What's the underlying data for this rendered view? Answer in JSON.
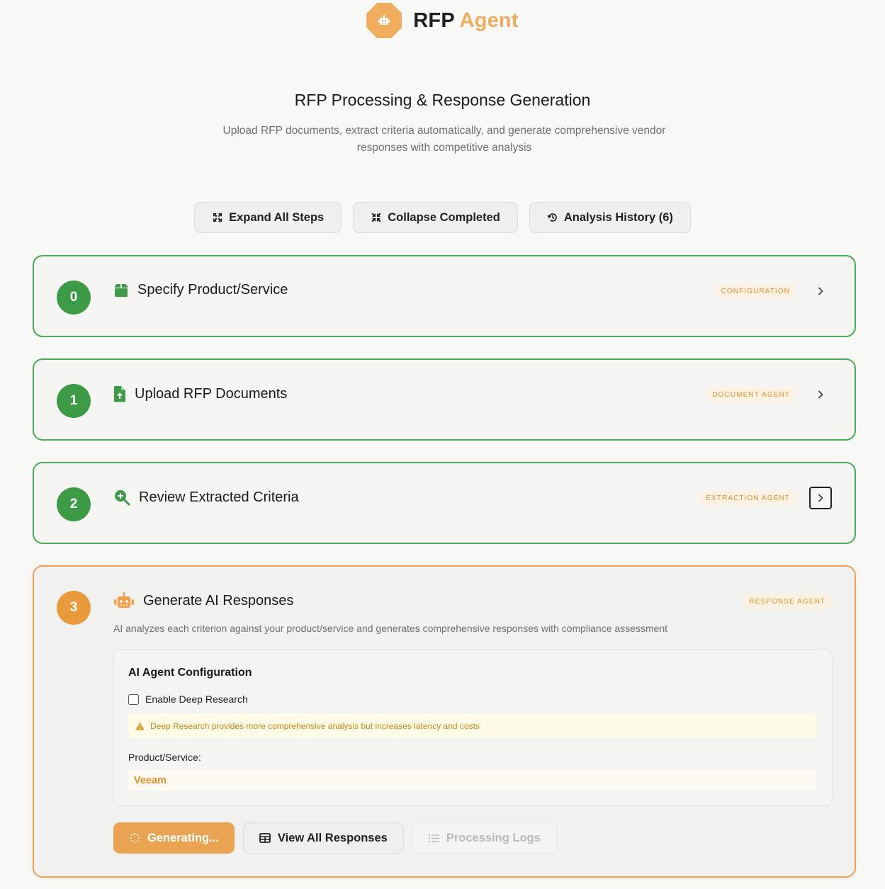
{
  "brand": {
    "name_part1": "RFP",
    "name_part2": "Agent",
    "logo_icon": "robot-icon"
  },
  "hero": {
    "title": "RFP Processing & Response Generation",
    "subtitle": "Upload RFP documents, extract criteria automatically, and generate comprehensive vendor responses with competitive analysis"
  },
  "toolbar": {
    "expand": "Expand All Steps",
    "collapse": "Collapse Completed",
    "history": "Analysis History (6)"
  },
  "steps": [
    {
      "number": "0",
      "title": "Specify Product/Service",
      "badge": "CONFIGURATION",
      "icon": "box-icon",
      "status": "completed"
    },
    {
      "number": "1",
      "title": "Upload RFP Documents",
      "badge": "DOCUMENT AGENT",
      "icon": "file-upload-icon",
      "status": "completed"
    },
    {
      "number": "2",
      "title": "Review Extracted Criteria",
      "badge": "EXTRACTION AGENT",
      "icon": "search-plus-icon",
      "status": "completed"
    },
    {
      "number": "3",
      "title": "Generate AI Responses",
      "badge": "RESPONSE AGENT",
      "icon": "robot-icon",
      "status": "active",
      "description": "AI analyzes each criterion against your product/service and generates comprehensive responses with compliance assessment"
    }
  ],
  "config": {
    "title": "AI Agent Configuration",
    "deep_research_label": "Enable Deep Research",
    "deep_research_checked": false,
    "warning": "Deep Research provides more comprehensive analysis but increases latency and costs",
    "product_label": "Product/Service:",
    "product_value": "Veeam"
  },
  "actions": {
    "generating": "Generating...",
    "view_all": "View All Responses",
    "logs": "Processing Logs"
  },
  "colors": {
    "accent": "#f0ad5e",
    "success": "#3d9b48",
    "success_border": "#4aab57",
    "active_border": "#eba15c",
    "badge_text": "#e3912c"
  }
}
